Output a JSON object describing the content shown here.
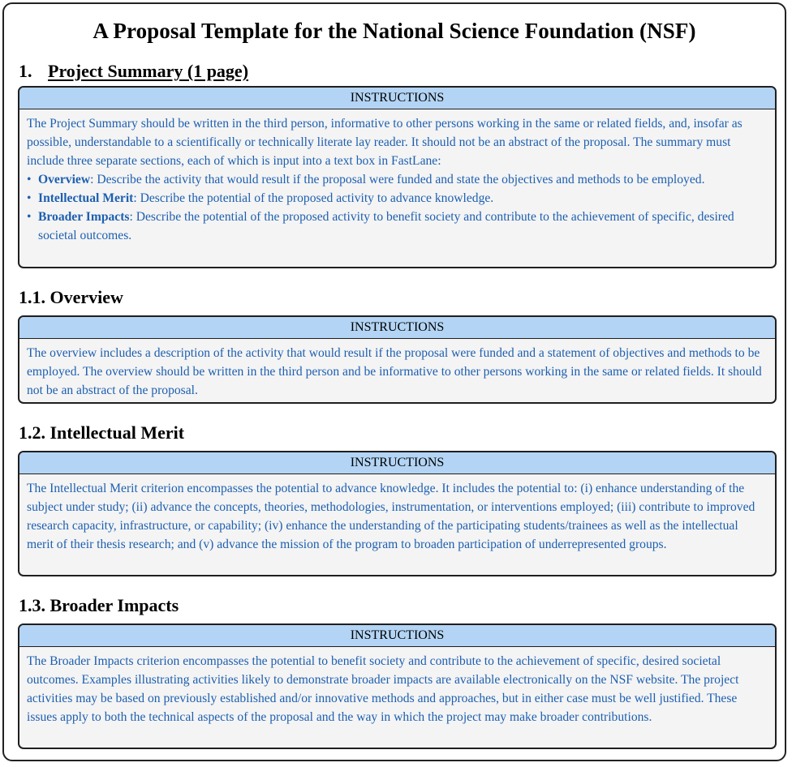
{
  "title": "A Proposal Template for the National Science Foundation (NSF)",
  "sections": {
    "project_summary": {
      "number": "1.",
      "heading": "Project Summary (1 page)"
    },
    "overview": {
      "heading": "1.1. Overview"
    },
    "intellectual_merit": {
      "heading": "1.2. Intellectual Merit"
    },
    "broader_impacts": {
      "heading": "1.3. Broader Impacts"
    }
  },
  "boxes": {
    "summary": {
      "header": "INSTRUCTIONS",
      "intro": "The Project Summary should be written in the third person, informative to other persons working in the same or related fields, and, insofar as possible, understandable to a scientifically or technically literate lay reader. It should not be an abstract of the proposal. The summary must include three separate sections, each of which is input into a text box in FastLane:",
      "bullets": [
        {
          "term": "Overview",
          "text": ": Describe the activity that would result if the proposal were funded and state the objectives and methods to be employed."
        },
        {
          "term": "Intellectual Merit",
          "text": ": Describe the potential of the proposed activity to advance knowledge."
        },
        {
          "term": "Broader Impacts",
          "text": ": Describe the potential of the proposed activity to benefit society and contribute to the achievement of specific, desired societal outcomes."
        }
      ]
    },
    "overview": {
      "header": "INSTRUCTIONS",
      "text": "The overview includes a description of the activity that would result if the proposal were funded and a statement of objectives and methods to be employed. The overview should be written in the third person and be informative to other persons working in the same or related fields. It should not be an abstract of the proposal."
    },
    "intellectual_merit": {
      "header": "INSTRUCTIONS",
      "text": "The Intellectual Merit criterion encompasses the potential to advance knowledge. It includes the potential to: (i) enhance understanding of the subject under study; (ii) advance the concepts, theories, methodologies, instrumentation, or interventions employed; (iii) contribute to improved research capacity, infrastructure, or capability; (iv) enhance the understanding of the participating students/trainees as well as the intellectual merit of their thesis research; and (v) advance the mission of the program to broaden participation of underrepresented groups."
    },
    "broader_impacts": {
      "header": "INSTRUCTIONS",
      "text": "The Broader Impacts criterion encompasses the potential to benefit society and contribute to the achievement of specific, desired societal outcomes. Examples illustrating activities likely to demonstrate broader impacts are available electronically on the NSF website. The project activities may be based on previously established and/or innovative methods and approaches, but in either case must be well justified. These issues apply to both the technical aspects of the proposal and the way in which the project may make broader contributions."
    }
  },
  "colors": {
    "instruction_text": "#1d5fb0",
    "header_fill": "#b3d4f4",
    "box_fill": "#f4f4f4"
  }
}
